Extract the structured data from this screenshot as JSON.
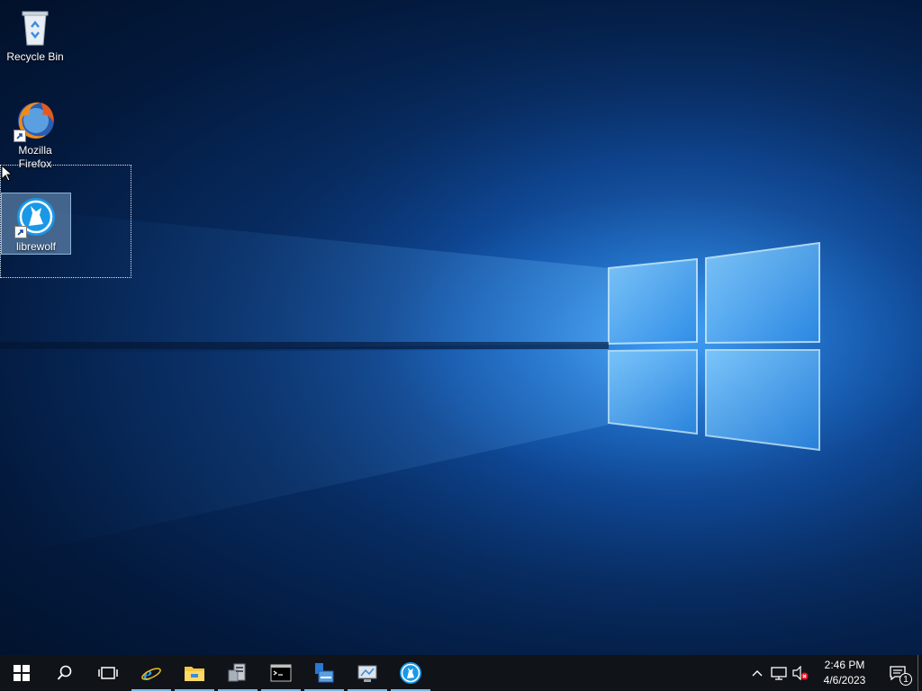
{
  "desktop": {
    "icons": [
      {
        "label": "Recycle Bin",
        "icon": "recycle-bin-icon"
      },
      {
        "label": "Mozilla Firefox",
        "icon": "firefox-icon"
      },
      {
        "label": "librewolf",
        "icon": "librewolf-icon",
        "selected": true
      }
    ]
  },
  "taskbar": {
    "buttons": [
      {
        "name": "start",
        "icon": "windows-logo-icon"
      },
      {
        "name": "search",
        "icon": "search-icon"
      },
      {
        "name": "task-view",
        "icon": "task-view-icon"
      },
      {
        "name": "internet-explorer",
        "icon": "internet-explorer-icon",
        "pinned": true
      },
      {
        "name": "file-explorer",
        "icon": "folder-icon",
        "pinned": true
      },
      {
        "name": "server-manager",
        "icon": "server-manager-icon",
        "pinned": true
      },
      {
        "name": "command-prompt",
        "icon": "command-prompt-icon",
        "pinned": true
      },
      {
        "name": "network-app",
        "icon": "network-app-icon",
        "pinned": true
      },
      {
        "name": "control-panel-app",
        "icon": "monitor-app-icon",
        "pinned": true
      },
      {
        "name": "librewolf",
        "icon": "librewolf-icon",
        "pinned": true
      }
    ],
    "tray": {
      "icons": [
        "chevron-up-icon",
        "network-icon",
        "volume-muted-icon"
      ],
      "time": "2:46 PM",
      "date": "4/6/2023",
      "notification_count": "1"
    }
  },
  "colors": {
    "taskbar_bg": "#101418",
    "accent": "#76b9ed",
    "selection_fill": "#78a0c8"
  }
}
